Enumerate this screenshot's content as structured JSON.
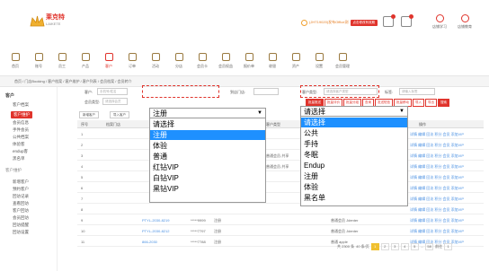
{
  "header": {
    "logo_title": "莱克特",
    "logo_sub": "LAIKETE",
    "user_info": "(JHT19020)发布Office测",
    "red_button": "点击修改有效期",
    "right_tabs": [
      "店铺学习",
      "店铺教育"
    ]
  },
  "nav": {
    "items": [
      "首页",
      "账号",
      "员工",
      "产品",
      "客户",
      "订单",
      "活动",
      "分店",
      "会员卡",
      "会员权益",
      "报价单",
      "收银",
      "资产",
      "设置",
      "会员管理"
    ],
    "active_index": 4
  },
  "breadcrumb": "首页 / 门店Booking / 客户档案 / 客户维护 / 客户列表 / 会员档案 / 会员转介",
  "sidebar": {
    "title": "客户",
    "items": [
      "客户档案",
      "客户维护",
      "会员信息",
      "手件会员",
      "公共档案",
      "体验客",
      "endup客",
      "黑名单",
      "客户维护",
      "新增客户",
      "预约客户",
      "回访记录",
      "查看回访",
      "客户回访",
      "会员回访",
      "回访提醒",
      "回访设置"
    ],
    "active_index": 1
  },
  "filters": {
    "customer_label": "客户:",
    "customer_placeholder": "手机号/姓名",
    "source_label": "到店门店:",
    "member_label": "会员类型:",
    "member_placeholder": "请选择会员",
    "type_label": "客户类型:",
    "type_placeholder": "请选择客户类型",
    "tag_label": "标签:",
    "tag_placeholder": "请输入标签"
  },
  "action_buttons": [
    "批量推送",
    "批量评价",
    "批量分组",
    "查询",
    "发送短信",
    "批量移动",
    "导入",
    "导出",
    "搜索"
  ],
  "left_actions": [
    "新增客户",
    "导入客户"
  ],
  "table": {
    "headers": [
      "序号",
      "档案门店",
      "姓名",
      "",
      "会员类型",
      "",
      "客户类型",
      "",
      "会员等级",
      "操作"
    ],
    "rows": [
      {
        "n": "1",
        "shop": "",
        "name": "",
        "phone": "",
        "type": "",
        "ctype": "",
        "level": "",
        "op": "详情 编辑 回访 积分 会员 添加VIP"
      },
      {
        "n": "2",
        "shop": "",
        "name": "",
        "phone": "",
        "type": "",
        "ctype": "",
        "level": "",
        "op": "详情 编辑 回访 积分 会员 添加VIP"
      },
      {
        "n": "3",
        "shop": "",
        "name": "",
        "phone": "",
        "type": "",
        "ctype": "普通会员-共享",
        "level": "",
        "op": "详情 编辑 回访 积分 会员 添加VIP"
      },
      {
        "n": "4",
        "shop": "",
        "name": "",
        "phone": "",
        "type": "",
        "ctype": "普通会员-共享",
        "level": "",
        "op": "详情 编辑 回访 积分 会员 添加VIP"
      },
      {
        "n": "5",
        "shop": "",
        "name": "",
        "phone": "",
        "type": "",
        "ctype": "",
        "level": "",
        "op": "详情 编辑 回访 积分 会员 添加VIP"
      },
      {
        "n": "6",
        "shop": "",
        "name": "",
        "phone": "",
        "type": "",
        "ctype": "",
        "level": "",
        "op": "详情 编辑 回访 积分 会员 添加VIP"
      },
      {
        "n": "7",
        "shop": "",
        "name": "",
        "phone": "",
        "type": "",
        "ctype": "",
        "level": "",
        "op": "详情 编辑 回访 积分 会员 添加VIP"
      },
      {
        "n": "8",
        "shop": "",
        "name": "",
        "phone": "",
        "type": "",
        "ctype": "",
        "level": "",
        "op": "详情 编辑 回访 积分 会员 添加VIP"
      },
      {
        "n": "9",
        "shop": "",
        "name": "PTYL-2030-8219",
        "phone": "*****9999",
        "type": "注册",
        "ctype": "",
        "level": "普通会员 Jdenter",
        "op": "详情 编辑 回访 积分 会员 添加VIP"
      },
      {
        "n": "10",
        "shop": "",
        "name": "PTYL-2030-8212",
        "phone": "*****7797",
        "type": "注册",
        "ctype": "",
        "level": "普通会员 Jdenter",
        "op": "详情 编辑 回访 积分 会员 添加VIP"
      },
      {
        "n": "11",
        "shop": "",
        "name": "866-2030",
        "phone": "*****7788",
        "type": "注册",
        "ctype": "",
        "level": "普通 apple",
        "op": "详情 编辑 回访 积分 会员 添加VIP"
      }
    ]
  },
  "pager": {
    "total": "共 2300 条",
    "per_page": "40 条/页",
    "pages": [
      "1",
      "2",
      "3",
      "4",
      "5",
      "...",
      "58"
    ],
    "goto": "前往",
    "current": "1"
  },
  "dropdown_left": {
    "selected": "注册",
    "options": [
      "请选择",
      "注册",
      "体验",
      "普通",
      "红钻VIP",
      "白钻VIP",
      "黑钻VIP"
    ],
    "highlighted_index": 1
  },
  "dropdown_right": {
    "selected": "请选择",
    "options": [
      "请选择",
      "公共",
      "手持",
      "冬眠",
      "Endup",
      "注册",
      "体验",
      "黑名单"
    ],
    "highlighted_index": 0
  },
  "colors": {
    "accent": "#e0342c",
    "highlight": "#1e90ff",
    "brand_gold": "#9a7a40"
  }
}
